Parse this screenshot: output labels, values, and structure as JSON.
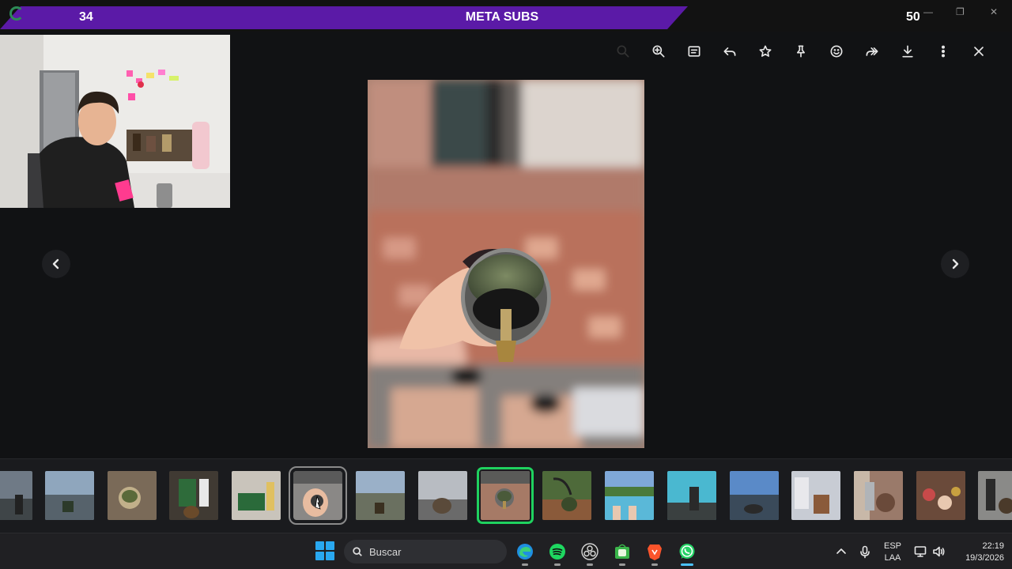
{
  "overlay": {
    "meta_start": "34",
    "meta_title": "META SUBS",
    "meta_goal": "50"
  },
  "toolbar": {
    "buttons": [
      {
        "icon": "search-icon",
        "state": "disabled"
      },
      {
        "icon": "zoom-in-icon"
      },
      {
        "icon": "caption-icon"
      },
      {
        "icon": "reply-icon"
      },
      {
        "icon": "star-icon"
      },
      {
        "icon": "pin-icon"
      },
      {
        "icon": "emoji-icon"
      },
      {
        "icon": "forward-icon"
      },
      {
        "icon": "download-icon"
      },
      {
        "icon": "more-icon"
      },
      {
        "icon": "close-icon"
      }
    ]
  },
  "viewer": {
    "image": "mate-gourd-photo",
    "prev_icon": "chevron-left-icon",
    "next_icon": "chevron-right-icon"
  },
  "thumbnails": {
    "selected_index": 8,
    "hover_index": 5,
    "count": 17
  },
  "taskbar": {
    "search_label": "Buscar",
    "language_top": "ESP",
    "language_bottom": "LAA",
    "time": "22:19",
    "date": "19/3/2026",
    "apps": [
      "edge-icon",
      "spotify-icon",
      "obs-icon",
      "android-store-icon",
      "brave-icon",
      "whatsapp-icon"
    ],
    "active_app": "whatsapp-icon"
  },
  "colors": {
    "meta_purple": "#5b1aa7",
    "selected_outline": "#1fd25f",
    "background": "#111214"
  }
}
